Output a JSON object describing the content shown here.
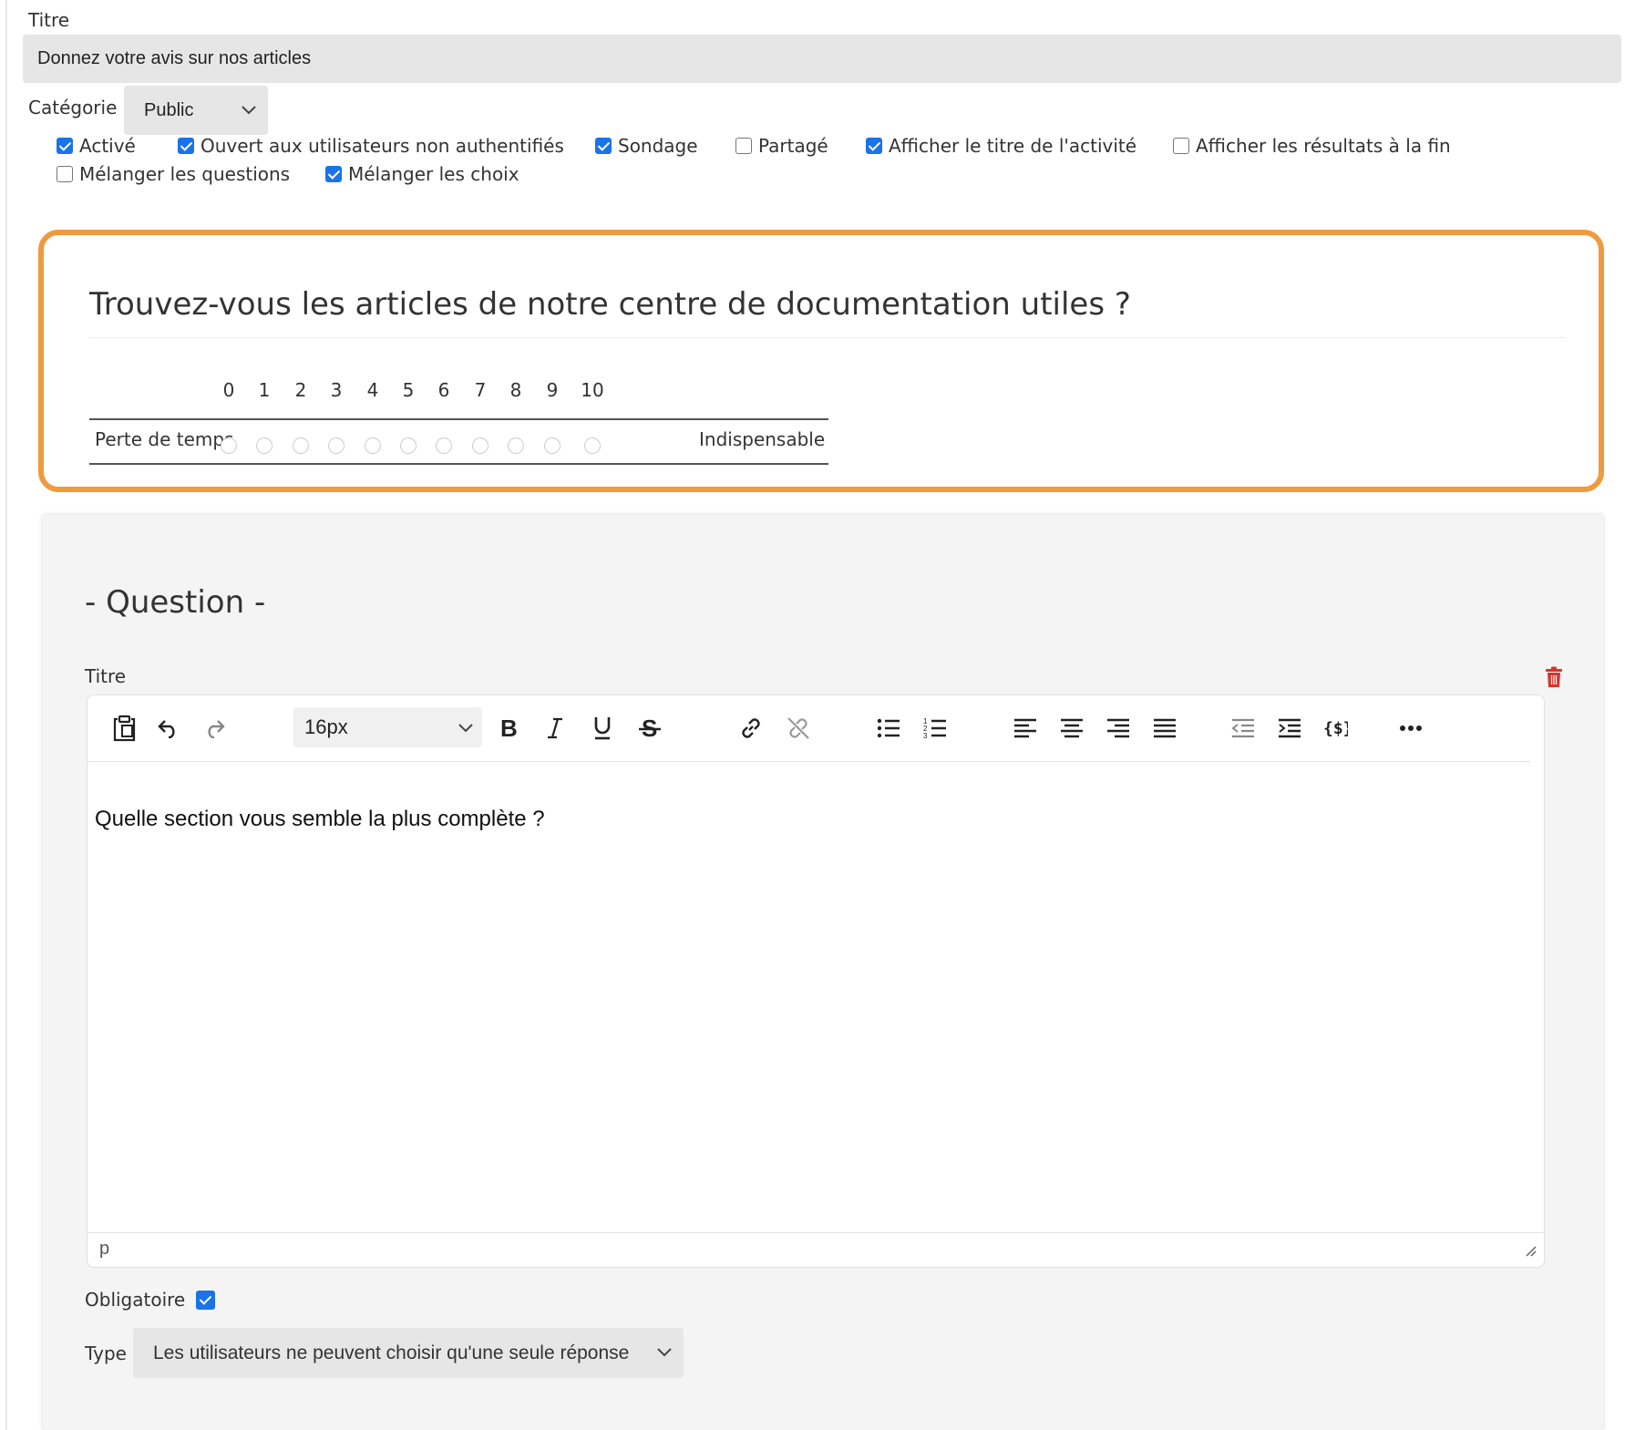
{
  "form": {
    "title_label": "Titre",
    "title_value": "Donnez votre avis sur nos articles",
    "category_label": "Catégorie",
    "category_value": "Public",
    "options": [
      {
        "label": "Activé",
        "checked": true
      },
      {
        "label": "Ouvert aux utilisateurs non authentifiés",
        "checked": true
      },
      {
        "label": "Sondage",
        "checked": true
      },
      {
        "label": "Partagé",
        "checked": false
      },
      {
        "label": "Afficher le titre de l'activité",
        "checked": true
      },
      {
        "label": "Afficher les résultats à la fin",
        "checked": false
      },
      {
        "label": "Mélanger les questions",
        "checked": false
      },
      {
        "label": "Mélanger les choix",
        "checked": true
      }
    ]
  },
  "preview": {
    "question": "Trouvez-vous les articles de notre centre de documentation utiles ?",
    "scale": [
      "0",
      "1",
      "2",
      "3",
      "4",
      "5",
      "6",
      "7",
      "8",
      "9",
      "10"
    ],
    "min_label": "Perte de temps",
    "max_label": "Indispensable",
    "highlight_color": "#ef9a3e"
  },
  "question_editor": {
    "heading": "- Question -",
    "title_label": "Titre",
    "font_size": "16px",
    "content": "Quelle section vous semble la plus complète ?",
    "path": "p",
    "toolbar": [
      "paste-icon",
      "undo-icon",
      "redo-icon",
      "bold-icon",
      "italic-icon",
      "underline-icon",
      "strikethrough-icon",
      "link-icon",
      "unlink-icon",
      "bullet-list-icon",
      "numbered-list-icon",
      "align-left-icon",
      "align-center-icon",
      "align-right-icon",
      "align-justify-icon",
      "outdent-icon",
      "indent-icon",
      "variable-icon",
      "more-icon"
    ],
    "required_label": "Obligatoire",
    "required": true,
    "type_label": "Type",
    "type_value": "Les utilisateurs ne peuvent choisir qu'une seule réponse",
    "accent": "#1a73e8",
    "delete_color": "#d9342b"
  }
}
